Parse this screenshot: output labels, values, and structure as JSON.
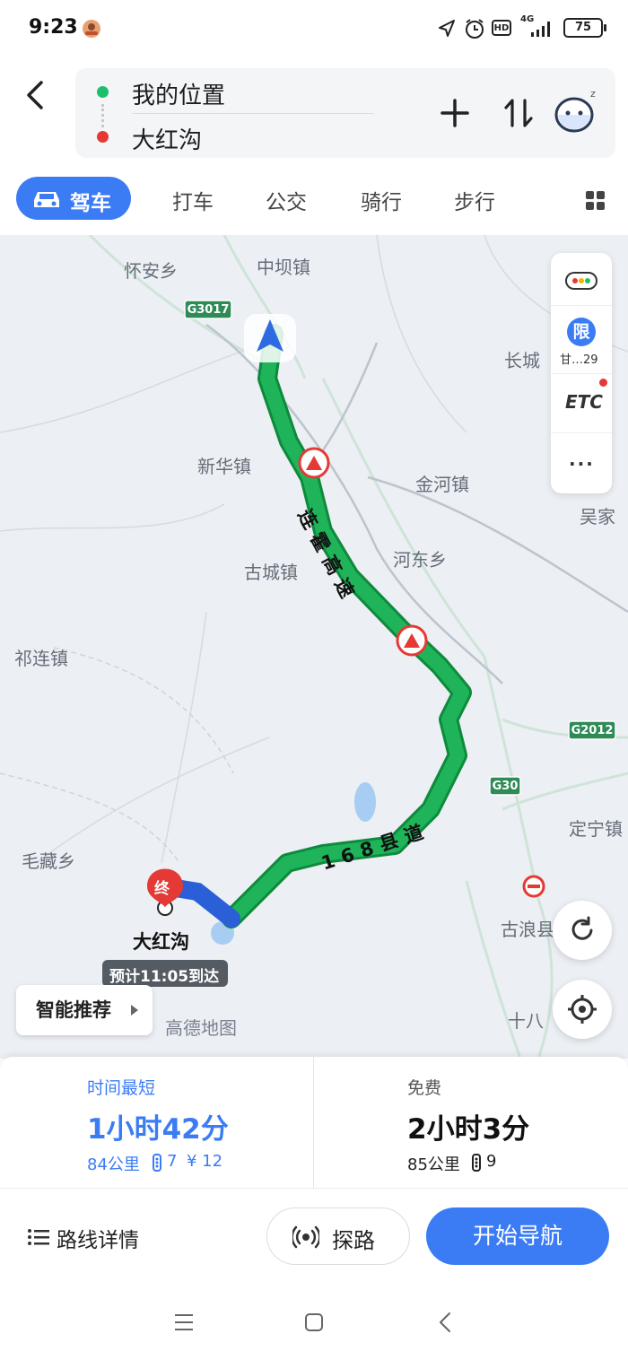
{
  "status_bar": {
    "time": "9:23",
    "network": "4G",
    "hd": "HD",
    "battery": "75"
  },
  "route_input": {
    "origin": "我的位置",
    "destination": "大红沟",
    "origin_color": "#1fbf6a",
    "destination_color": "#e53935"
  },
  "tabs": {
    "active": "驾车",
    "others": [
      "打车",
      "公交",
      "骑行",
      "步行"
    ]
  },
  "map": {
    "places": [
      "怀安乡",
      "中坝镇",
      "新华镇",
      "金河镇",
      "古城镇",
      "河东乡",
      "祁连镇",
      "毛藏乡",
      "长城",
      "吴家",
      "定宁镇",
      "古浪县",
      "十八"
    ],
    "highways": [
      "G3017",
      "G2012",
      "G30"
    ],
    "road_names": [
      "连霍高速",
      "168县道"
    ],
    "destination_label": "大红沟",
    "end_marker": "终",
    "eta": "预计11:05到达",
    "watermark": "高德地图",
    "smart_recommend": "智能推荐",
    "side_panel": {
      "limit_icon": "限",
      "limit_text": "甘…29",
      "etc": "ETC",
      "more": "..."
    },
    "route_color": "#1fb45a",
    "route_border": "#0e8a3d"
  },
  "routes": [
    {
      "tag": "时间最短",
      "time": "1小时42分",
      "distance": "84公里",
      "lights": "7",
      "toll": "¥ 12",
      "selected": true
    },
    {
      "tag": "免费",
      "time": "2小时3分",
      "distance": "85公里",
      "lights": "9",
      "toll": "",
      "selected": false
    }
  ],
  "actions": {
    "detail": "路线详情",
    "probe": "探路",
    "start": "开始导航"
  },
  "accent": "#3b7cf5"
}
